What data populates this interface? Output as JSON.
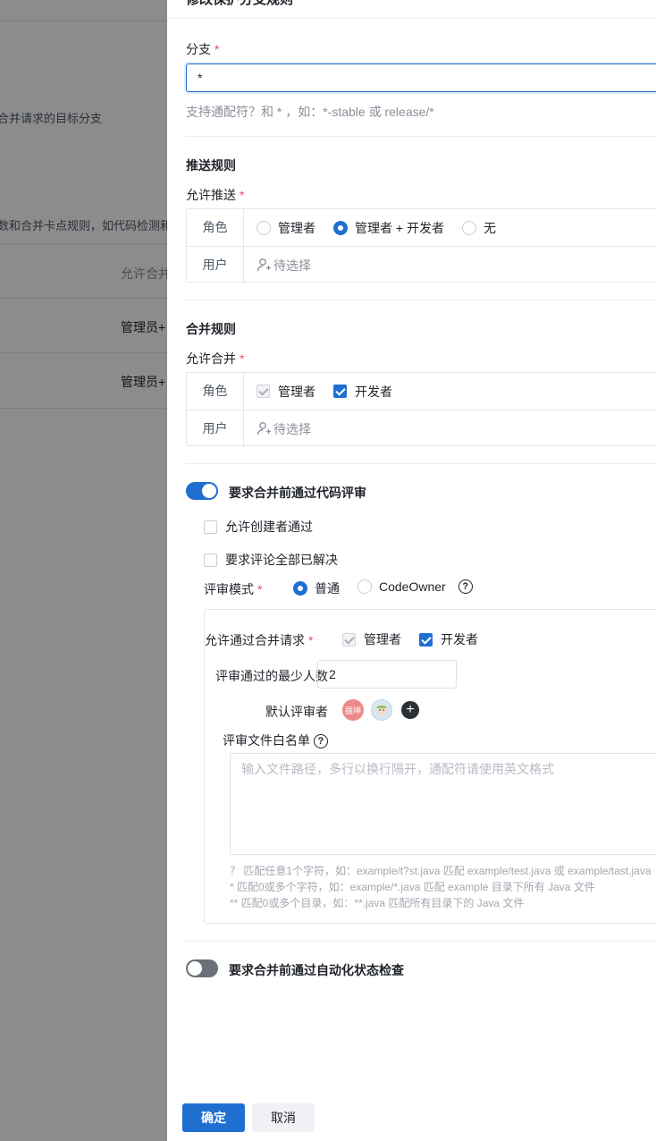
{
  "background": {
    "text1": "合并请求的目标分支",
    "text2": "数和合并卡点规则，如代码检测和",
    "col_header": "允许合并",
    "row1": "管理员+",
    "row2": "管理员+"
  },
  "drawer": {
    "title": "修改保护分支规则",
    "branch": {
      "label": "分支",
      "value": "*",
      "hint": "支持通配符？和 * ，如：*-stable 或 release/*"
    },
    "push": {
      "section": "推送规则",
      "label": "允许推送",
      "role_header": "角色",
      "user_header": "用户",
      "options": [
        "管理者",
        "管理者 + 开发者",
        "无"
      ],
      "user_placeholder": "待选择"
    },
    "merge": {
      "section": "合并规则",
      "label": "允许合并",
      "role_header": "角色",
      "user_header": "用户",
      "opt_manager": "管理者",
      "opt_developer": "开发者",
      "user_placeholder": "待选择"
    },
    "review": {
      "toggle_label": "要求合并前通过代码评审",
      "allow_creator": "允许创建者通过",
      "require_resolved": "要求评论全部已解决",
      "mode_label": "评审模式",
      "mode_normal": "普通",
      "mode_codeowner": "CodeOwner",
      "allow_label": "允许通过合并请求",
      "allow_manager": "管理者",
      "allow_developer": "开发者",
      "min_label": "评审通过的最少人数",
      "min_value": "2",
      "default_reviewers_label": "默认评审者",
      "avatar1_text": "振坤",
      "whitelist_label": "评审文件白名单",
      "whitelist_placeholder": "输入文件路径，多行以换行隔开，通配符请使用英文格式",
      "help1": "？ 匹配任意1个字符，如：example/t?st.java 匹配 example/test.java 或 example/tast.java",
      "help2": "* 匹配0或多个字符，如：example/*.java 匹配 example 目录下所有 Java 文件",
      "help3": "** 匹配0或多个目录，如：**.java 匹配所有目录下的 Java 文件"
    },
    "auto_check": {
      "toggle_label": "要求合并前通过自动化状态检查"
    },
    "footer": {
      "confirm": "确定",
      "cancel": "取消"
    },
    "colors": {
      "primary": "#1f6fd1",
      "required": "#e34d59"
    }
  }
}
